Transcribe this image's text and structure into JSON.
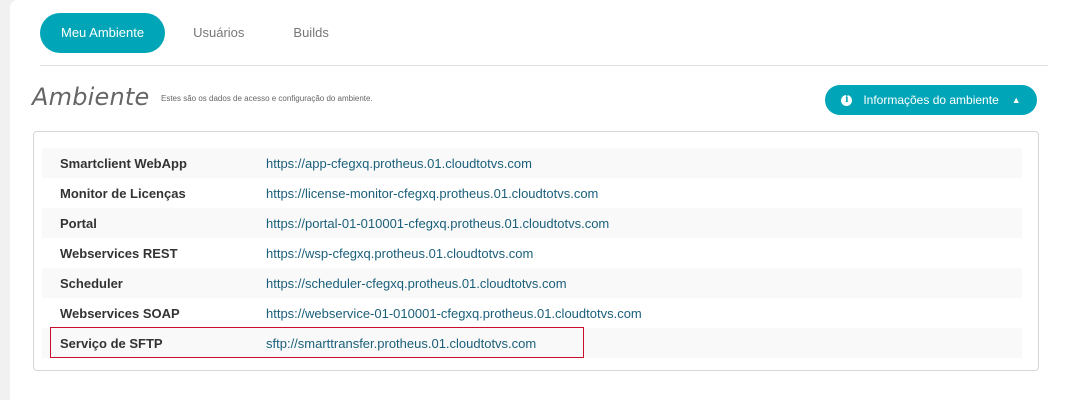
{
  "tabs": [
    {
      "label": "Meu Ambiente",
      "active": true
    },
    {
      "label": "Usuários",
      "active": false
    },
    {
      "label": "Builds",
      "active": false
    }
  ],
  "header": {
    "title": "Ambiente",
    "subtitle": "Estes são os dados de acesso e configuração do ambiente."
  },
  "info_button": {
    "label": "Informações do ambiente",
    "icon": "info-icon",
    "chevron": "chevron-up-icon"
  },
  "services": [
    {
      "label": "Smartclient WebApp",
      "url": "https://app-cfegxq.protheus.01.cloudtotvs.com"
    },
    {
      "label": "Monitor de Licenças",
      "url": "https://license-monitor-cfegxq.protheus.01.cloudtotvs.com"
    },
    {
      "label": "Portal",
      "url": "https://portal-01-010001-cfegxq.protheus.01.cloudtotvs.com"
    },
    {
      "label": "Webservices REST",
      "url": "https://wsp-cfegxq.protheus.01.cloudtotvs.com"
    },
    {
      "label": "Scheduler",
      "url": "https://scheduler-cfegxq.protheus.01.cloudtotvs.com"
    },
    {
      "label": "Webservices SOAP",
      "url": "https://webservice-01-010001-cfegxq.protheus.01.cloudtotvs.com"
    },
    {
      "label": "Serviço de SFTP",
      "url": "sftp://smarttransfer.protheus.01.cloudtotvs.com"
    }
  ],
  "colors": {
    "accent": "#00a6b8",
    "link": "#1a5f7a",
    "highlight_border": "#c8102e"
  }
}
